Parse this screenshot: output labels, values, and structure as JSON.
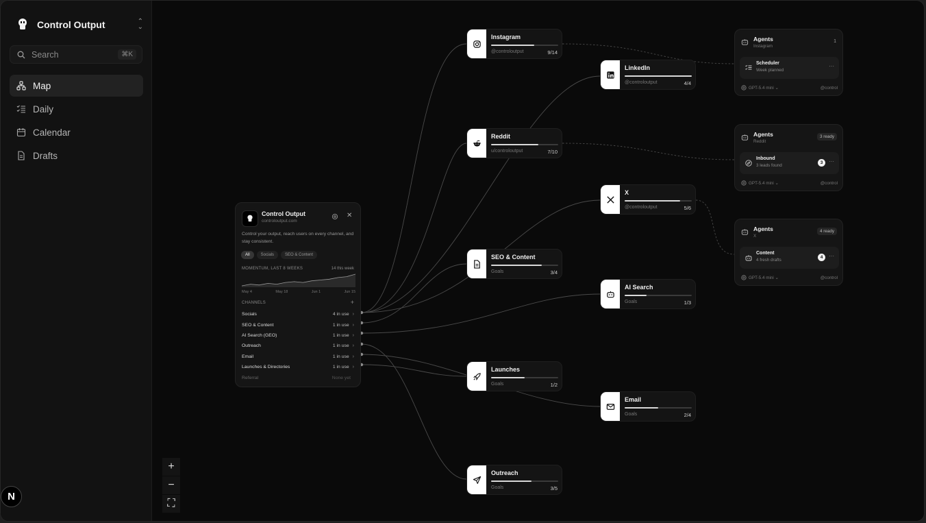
{
  "sidebar": {
    "app_name": "Control Output",
    "search": {
      "placeholder": "Search",
      "shortcut": "⌘K"
    },
    "nav": [
      {
        "label": "Map",
        "icon": "map-icon",
        "active": true
      },
      {
        "label": "Daily",
        "icon": "checklist-icon",
        "active": false
      },
      {
        "label": "Calendar",
        "icon": "calendar-icon",
        "active": false
      },
      {
        "label": "Drafts",
        "icon": "document-icon",
        "active": false
      }
    ],
    "badge": "N"
  },
  "canvas": {
    "zoom_controls": {
      "zoom_in": "+",
      "zoom_out": "−",
      "fit": "⛶"
    },
    "project_card": {
      "title": "Control Output",
      "url": "controloutput.com",
      "description": "Control your output, reach users on every channel, and stay consistent.",
      "filters": [
        "All",
        "Socials",
        "SEO & Content"
      ],
      "momentum_label": "MOMENTUM, LAST 8 WEEKS",
      "momentum_note": "14 this week",
      "sparkline": [
        2,
        3,
        2.5,
        3.5,
        3,
        4,
        4.5,
        4,
        5,
        5.5,
        6,
        7,
        7.5,
        9
      ],
      "dates": [
        "May 4",
        "May 18",
        "Jun 1",
        "Jun 15"
      ],
      "channels_label": "CHANNELS",
      "add_label": "+",
      "channels": [
        {
          "name": "Socials",
          "usage": "4 in use"
        },
        {
          "name": "SEO & Content",
          "usage": "1 in use"
        },
        {
          "name": "AI Search (GEO)",
          "usage": "1 in use"
        },
        {
          "name": "Outreach",
          "usage": "1 in use"
        },
        {
          "name": "Email",
          "usage": "1 in use"
        },
        {
          "name": "Launches & Directories",
          "usage": "1 in use"
        },
        {
          "name": "Referral",
          "usage": "None yet"
        }
      ]
    },
    "nodes": {
      "instagram": {
        "title": "Instagram",
        "sub": "@controloutput",
        "count": "9/14",
        "progress": 0.64
      },
      "linkedin": {
        "title": "LinkedIn",
        "sub": "@controloutput",
        "count": "4/4",
        "progress": 1.0
      },
      "reddit": {
        "title": "Reddit",
        "sub": "u/controloutput",
        "count": "7/10",
        "progress": 0.7
      },
      "x": {
        "title": "X",
        "sub": "@controloutput",
        "count": "5/6",
        "progress": 0.83
      },
      "seo": {
        "title": "SEO & Content",
        "sub": "Goals",
        "count": "3/4",
        "progress": 0.75
      },
      "ai_search": {
        "title": "AI Search",
        "sub": "Goals",
        "count": "1/3",
        "progress": 0.33
      },
      "launches": {
        "title": "Launches",
        "sub": "Goals",
        "count": "1/2",
        "progress": 0.5
      },
      "email": {
        "title": "Email",
        "sub": "Goals",
        "count": "2/4",
        "progress": 0.5
      },
      "outreach": {
        "title": "Outreach",
        "sub": "Goals",
        "count": "3/5",
        "progress": 0.6
      }
    },
    "agents": [
      {
        "title": "Agents",
        "sub": "Instagram",
        "count": "1",
        "task_title": "Scheduler",
        "task_sub": "Week planned",
        "task_num": "",
        "model": "GPT-5.4 mini",
        "handle": "@control"
      },
      {
        "title": "Agents",
        "sub": "Reddit",
        "badge": "3 ready",
        "task_title": "Inbound",
        "task_sub": "3 leads found",
        "task_num": "3",
        "model": "GPT-5.4 mini",
        "handle": "@control"
      },
      {
        "title": "Agents",
        "sub": "X",
        "badge": "4 ready",
        "task_title": "Content",
        "task_sub": "4 fresh drafts",
        "task_num": "4",
        "model": "GPT-5.4 mini",
        "handle": "@control"
      }
    ]
  }
}
